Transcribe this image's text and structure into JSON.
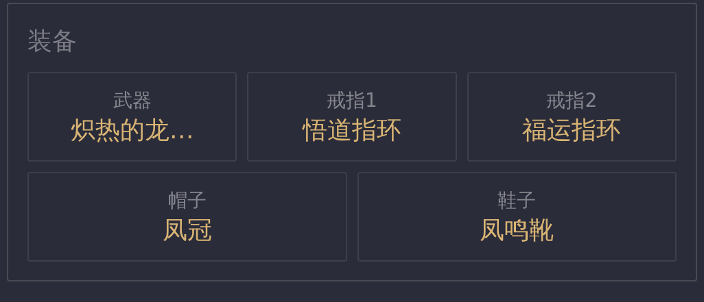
{
  "panel": {
    "title": "装备",
    "rows": [
      [
        {
          "label": "武器",
          "value": "炽热的龙…"
        },
        {
          "label": "戒指1",
          "value": "悟道指环"
        },
        {
          "label": "戒指2",
          "value": "福运指环"
        }
      ],
      [
        {
          "label": "帽子",
          "value": "凤冠"
        },
        {
          "label": "鞋子",
          "value": "凤鸣靴"
        }
      ]
    ]
  }
}
